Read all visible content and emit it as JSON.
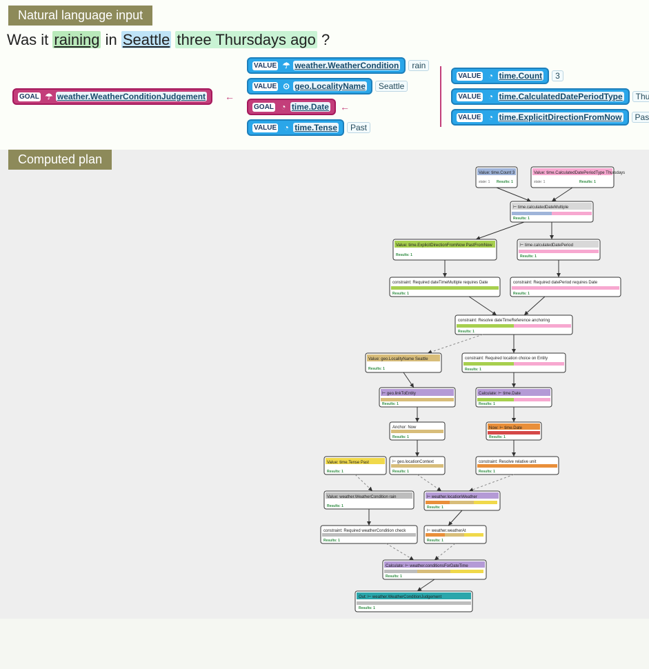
{
  "headers": {
    "nl": "Natural language input",
    "plan": "Computed plan"
  },
  "sentence": {
    "pre1": "Was it ",
    "raining": "raining",
    "in": " in ",
    "seattle": "Seattle",
    "sp": " ",
    "three_thursdays": "three Thursdays ago",
    "post": "?"
  },
  "labels": {
    "goal": "GOAL",
    "value": "VALUE"
  },
  "icons": {
    "umbrella": "☂",
    "globe": "⊙",
    "clock": "◔"
  },
  "parse": {
    "goal1_type": "weather.WeatherConditionJudgement",
    "v_cond_type": "weather.WeatherCondition",
    "v_cond_val": "rain",
    "v_loc_type": "geo.LocalityName",
    "v_loc_val": "Seattle",
    "goal2_type": "time.Date",
    "v_count_type": "time.Count",
    "v_count_val": "3",
    "v_period_type": "time.CalculatedDatePeriodType",
    "v_period_val": "Thursdays",
    "v_dir_type": "time.ExplicitDirectionFromNow",
    "v_dir_val": "PastFromNow",
    "v_tense_type": "time.Tense",
    "v_tense_val": "Past"
  },
  "plan_nodes": {
    "n_count": "Value: time.Count 3",
    "n_period": "Value: time.CalculatedDatePeriodType Thursdays",
    "n_multi": "⊢ time.calculatedDateMultiple",
    "n_dir": "Value: time.ExplicitDirectionFromNow PastFromNow",
    "n_per2": "⊢ time.calculatedDatePeriod",
    "n_req1": "constraint: Required dateTimeMultiple requires Date",
    "n_req2": "constraint: Required datePeriod requires Date",
    "n_ref": "constraint: Resolve dateTimeReference anchoring",
    "n_loc": "Value: geo.LocalityName Seattle",
    "n_resloc": "constraint: Required location choice on Entity",
    "n_geolink": "⊢ geo.linkToEntity",
    "n_anchor": "Anchor: Now",
    "n_calcdate": "Calculate: ⊢ time.Date",
    "n_orange": "Now: ⊢ time.Date",
    "n_resunit": "constraint: Resolve relative unit",
    "n_locctx": "⊢ geo.locationContext",
    "n_tense": "Value: time.Tense Past",
    "n_wcond": "Value: weather.WeatherCondition rain",
    "n_join": "⊢ weather.locationWeather",
    "n_reqcond": "constraint: Required weatherCondition check",
    "n_weather": "⊢ weather.weatherAt",
    "n_gather": "Calculate: ⊢ weather.conditionsForDateTime",
    "n_final": "Out: ⊢ weather.WeatherConditionJudgement",
    "results": "Results: 1",
    "state": "state: 1"
  }
}
